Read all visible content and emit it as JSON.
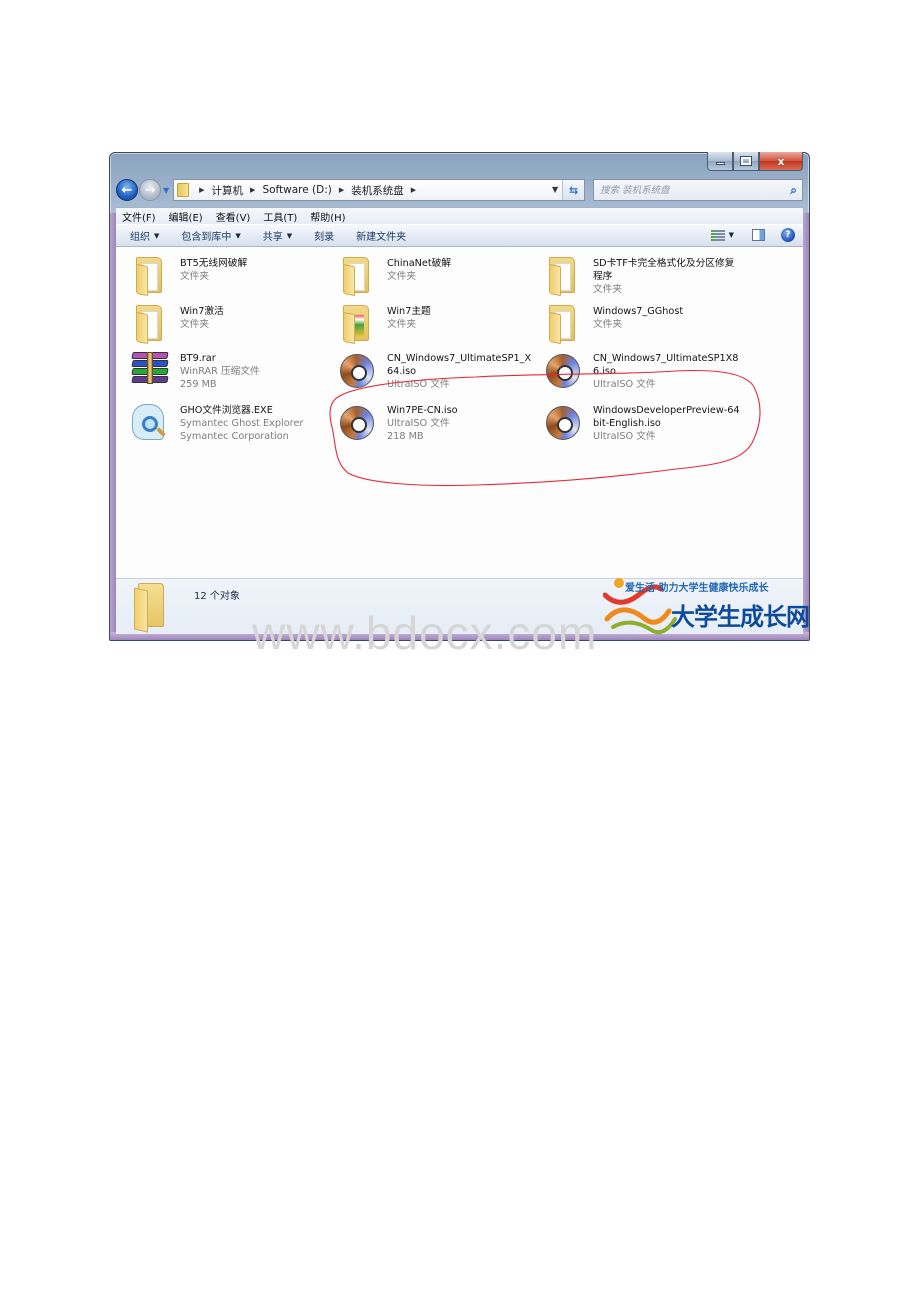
{
  "window": {
    "caption_buttons": {
      "minimize": "minimize",
      "maximize": "maximize",
      "close": "x"
    }
  },
  "nav": {
    "back_label": "◀",
    "forward_label": "▶",
    "breadcrumbs": [
      "计算机",
      "Software (D:)",
      "装机系统盘"
    ],
    "search_placeholder": "搜索 装机系统盘"
  },
  "menu": {
    "items": [
      "文件(F)",
      "编辑(E)",
      "查看(V)",
      "工具(T)",
      "帮助(H)"
    ]
  },
  "toolbar": {
    "items": [
      {
        "label": "组织",
        "has_dropdown": true
      },
      {
        "label": "包含到库中",
        "has_dropdown": true
      },
      {
        "label": "共享",
        "has_dropdown": true
      },
      {
        "label": "刻录",
        "has_dropdown": false
      },
      {
        "label": "新建文件夹",
        "has_dropdown": false
      }
    ],
    "help_label": "?"
  },
  "files": [
    {
      "name": "BT5无线网破解",
      "meta": [
        "文件夹"
      ],
      "icon": "folder-icon"
    },
    {
      "name": "ChinaNet破解",
      "meta": [
        "文件夹"
      ],
      "icon": "folder-icon"
    },
    {
      "name": "SD卡TF卡完全格式化及分区修复程序",
      "meta": [
        "文件夹"
      ],
      "icon": "folder-icon"
    },
    {
      "name": "Win7激活",
      "meta": [
        "文件夹"
      ],
      "icon": "folder-icon"
    },
    {
      "name": "Win7主题",
      "meta": [
        "文件夹"
      ],
      "icon": "theme-folder-icon"
    },
    {
      "name": "Windows7_GGhost",
      "meta": [
        "文件夹"
      ],
      "icon": "folder-icon"
    },
    {
      "name": "BT9.rar",
      "meta": [
        "WinRAR 压缩文件",
        "259 MB"
      ],
      "icon": "winrar-archive-icon"
    },
    {
      "name": "CN_Windows7_UltimateSP1_X64.iso",
      "meta": [
        "UltraISO 文件"
      ],
      "icon": "disc-image-icon"
    },
    {
      "name": "CN_Windows7_UltimateSP1X86.iso",
      "meta": [
        "UltraISO 文件"
      ],
      "icon": "disc-image-icon"
    },
    {
      "name": "GHO文件浏览器.EXE",
      "meta": [
        "Symantec Ghost Explorer",
        "Symantec Corporation"
      ],
      "icon": "ghost-explorer-icon"
    },
    {
      "name": "Win7PE-CN.iso",
      "meta": [
        "UltraISO 文件",
        "218 MB"
      ],
      "icon": "disc-image-icon"
    },
    {
      "name": "WindowsDeveloperPreview-64bit-English.iso",
      "meta": [
        "UltraISO 文件"
      ],
      "icon": "disc-image-icon"
    }
  ],
  "status": {
    "count_text": "12 个对象"
  },
  "logo": {
    "slogan": "爱生活  助力大学生健康快乐成长",
    "name": "大学生成长网"
  },
  "page_watermark": "www.bdocx.com",
  "colors": {
    "annotation_circle": "#e8283a",
    "logo_blue": "#0d4a9b",
    "window_frame": "#b9cade"
  }
}
